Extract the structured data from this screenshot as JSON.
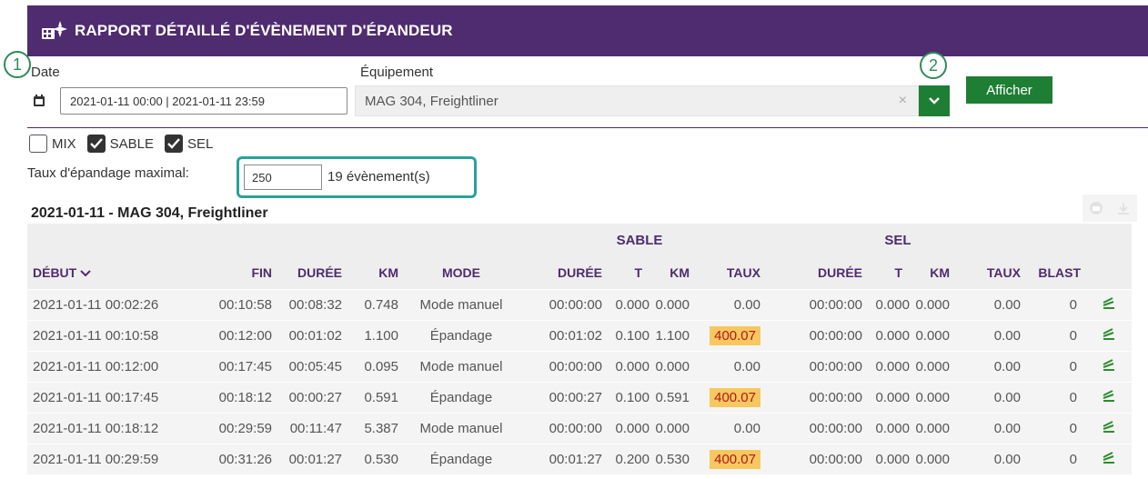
{
  "header": {
    "title": "RAPPORT DÉTAILLÉ D'ÉVÈNEMENT D'ÉPANDEUR",
    "accent": "#4f2b6f"
  },
  "annotations": {
    "badge1": "1",
    "badge2": "2"
  },
  "filters": {
    "date_label": "Date",
    "date_value": "2021-01-11 00:00 | 2021-01-11 23:59",
    "equipment_label": "Équipement",
    "equipment_value": "MAG 304, Freightliner",
    "show_button": "Afficher",
    "button_color": "#1e7e34"
  },
  "checkboxes": [
    {
      "label": "MIX",
      "checked": false
    },
    {
      "label": "SABLE",
      "checked": true
    },
    {
      "label": "SEL",
      "checked": true
    }
  ],
  "rate": {
    "label": "Taux d'épandage maximal:",
    "value": "250",
    "events": "19 évènement(s)"
  },
  "report": {
    "title": "2021-01-11 - MAG 304, Freightliner"
  },
  "table": {
    "groups": {
      "sable": "SABLE",
      "sel": "SEL"
    },
    "columns": {
      "debut": "DÉBUT",
      "fin": "FIN",
      "duree": "DURÉE",
      "km": "KM",
      "mode": "MODE",
      "sable_duree": "DURÉE",
      "sable_t": "T",
      "sable_km": "KM",
      "sable_taux": "TAUX",
      "sel_duree": "DURÉE",
      "sel_t": "T",
      "sel_km": "KM",
      "sel_taux": "TAUX",
      "blast": "BLAST"
    },
    "rows": [
      {
        "debut": "2021-01-11 00:02:26",
        "fin": "00:10:58",
        "duree": "00:08:32",
        "km": "0.748",
        "mode": "Mode manuel",
        "s_duree": "00:00:00",
        "s_t": "0.000",
        "s_km": "0.000",
        "s_taux": "0.00",
        "s_hl": false,
        "e_duree": "00:00:00",
        "e_t": "0.000",
        "e_km": "0.000",
        "e_taux": "0.00",
        "blast": "0"
      },
      {
        "debut": "2021-01-11 00:10:58",
        "fin": "00:12:00",
        "duree": "00:01:02",
        "km": "1.100",
        "mode": "Épandage",
        "s_duree": "00:01:02",
        "s_t": "0.100",
        "s_km": "1.100",
        "s_taux": "400.07",
        "s_hl": true,
        "e_duree": "00:00:00",
        "e_t": "0.000",
        "e_km": "0.000",
        "e_taux": "0.00",
        "blast": "0"
      },
      {
        "debut": "2021-01-11 00:12:00",
        "fin": "00:17:45",
        "duree": "00:05:45",
        "km": "0.095",
        "mode": "Mode manuel",
        "s_duree": "00:00:00",
        "s_t": "0.000",
        "s_km": "0.000",
        "s_taux": "0.00",
        "s_hl": false,
        "e_duree": "00:00:00",
        "e_t": "0.000",
        "e_km": "0.000",
        "e_taux": "0.00",
        "blast": "0"
      },
      {
        "debut": "2021-01-11 00:17:45",
        "fin": "00:18:12",
        "duree": "00:00:27",
        "km": "0.591",
        "mode": "Épandage",
        "s_duree": "00:00:27",
        "s_t": "0.100",
        "s_km": "0.591",
        "s_taux": "400.07",
        "s_hl": true,
        "e_duree": "00:00:00",
        "e_t": "0.000",
        "e_km": "0.000",
        "e_taux": "0.00",
        "blast": "0"
      },
      {
        "debut": "2021-01-11 00:18:12",
        "fin": "00:29:59",
        "duree": "00:11:47",
        "km": "5.387",
        "mode": "Mode manuel",
        "s_duree": "00:00:00",
        "s_t": "0.000",
        "s_km": "0.000",
        "s_taux": "0.00",
        "s_hl": false,
        "e_duree": "00:00:00",
        "e_t": "0.000",
        "e_km": "0.000",
        "e_taux": "0.00",
        "blast": "0"
      },
      {
        "debut": "2021-01-11 00:29:59",
        "fin": "00:31:26",
        "duree": "00:01:27",
        "km": "0.530",
        "mode": "Épandage",
        "s_duree": "00:01:27",
        "s_t": "0.200",
        "s_km": "0.530",
        "s_taux": "400.07",
        "s_hl": true,
        "e_duree": "00:00:00",
        "e_t": "0.000",
        "e_km": "0.000",
        "e_taux": "0.00",
        "blast": "0"
      }
    ],
    "highlight_color": "#f6c85f"
  },
  "icons": {
    "title": "spreader-report-icon",
    "calendar": "calendar-icon",
    "dropdown": "chevron-down-icon",
    "print": "print-icon",
    "download": "download-icon",
    "chart": "chart-icon"
  }
}
